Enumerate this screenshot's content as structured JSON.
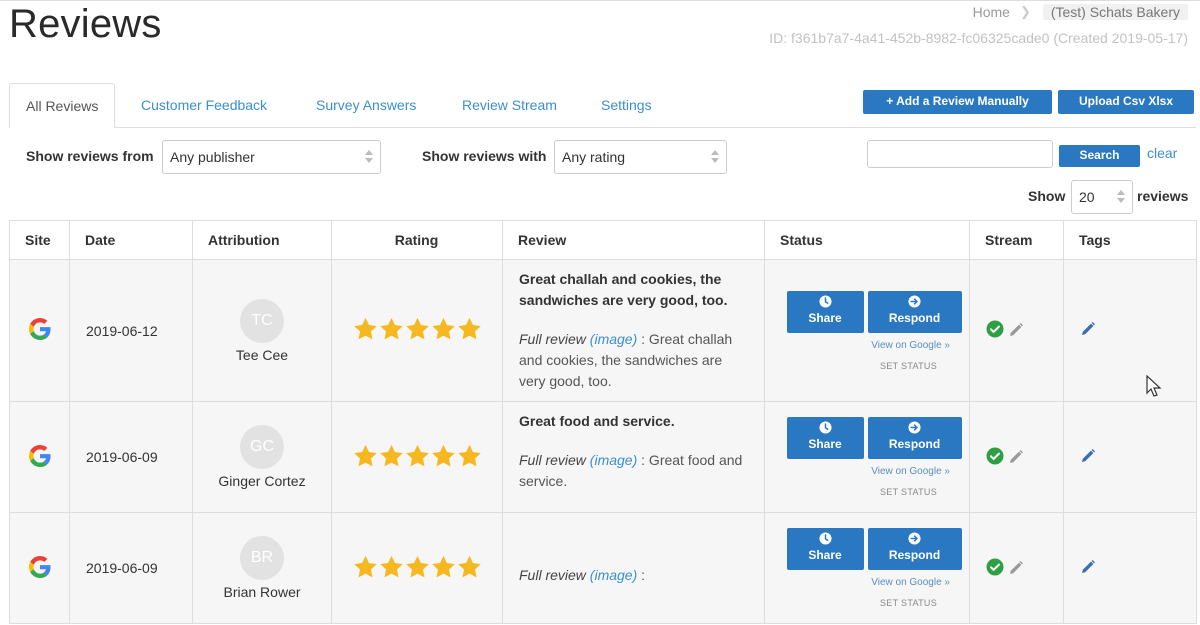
{
  "page": {
    "title": "Reviews",
    "breadcrumb": {
      "home": "Home",
      "current": "(Test) Schats Bakery"
    },
    "id_line": "ID: f361b7a7-4a41-452b-8982-fc06325cade0 (Created 2019-05-17)"
  },
  "tabs": [
    "All Reviews",
    "Customer Feedback",
    "Survey Answers",
    "Review Stream",
    "Settings"
  ],
  "active_tab": "All Reviews",
  "actions": {
    "add_review": "+ Add a Review Manually",
    "upload_csv": "Upload Csv Xlsx"
  },
  "filters": {
    "publisher_label": "Show reviews from",
    "publisher_value": "Any publisher",
    "rating_label": "Show reviews with",
    "rating_value": "Any rating",
    "search_value": "",
    "search_button": "Search",
    "clear": "clear",
    "show_label": "Show",
    "show_count": "20",
    "show_suffix": "reviews"
  },
  "table": {
    "headers": [
      "Site",
      "Date",
      "Attribution",
      "Rating",
      "Review",
      "Status",
      "Stream",
      "Tags"
    ],
    "rows": [
      {
        "site": "google-icon",
        "date": "2019-06-12",
        "initials": "TC",
        "name": "Tee Cee",
        "rating": 5,
        "headline": "Great challah and cookies, the sandwiches are very good, too.",
        "full_label": "Full review",
        "image_link": "(image)",
        "full_text": ": Great challah and cookies, the sandwiches are very good, too.",
        "share": "Share",
        "respond": "Respond",
        "view_link": "View on Google »",
        "set_status": "SET STATUS"
      },
      {
        "site": "google-icon",
        "date": "2019-06-09",
        "initials": "GC",
        "name": "Ginger Cortez",
        "rating": 5,
        "headline": "Great food and service.",
        "full_label": "Full review",
        "image_link": "(image)",
        "full_text": ": Great food and service.",
        "share": "Share",
        "respond": "Respond",
        "view_link": "View on Google »",
        "set_status": "SET STATUS"
      },
      {
        "site": "google-icon",
        "date": "2019-06-09",
        "initials": "BR",
        "name": "Brian Rower",
        "rating": 5,
        "headline": "",
        "full_label": "Full review",
        "image_link": "(image)",
        "full_text": ":",
        "share": "Share",
        "respond": "Respond",
        "view_link": "View on Google »",
        "set_status": "SET STATUS"
      }
    ]
  },
  "colors": {
    "primary": "#2a78c2",
    "link": "#3b8fcf",
    "star": "#f5b820",
    "check": "#2ea043",
    "row_bg": "#f6f6f6"
  }
}
